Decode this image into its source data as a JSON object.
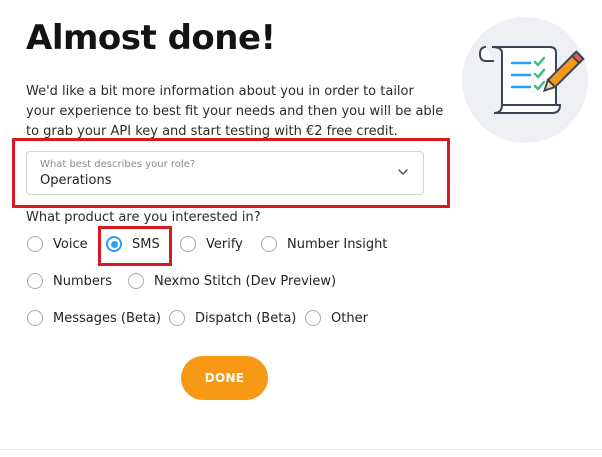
{
  "page": {
    "title": "Almost done!",
    "intro": "We'd like a bit more information about you in order to tailor your experience to best fit your needs and then you will be able to grab your API key and start testing with €2 free credit."
  },
  "role_select": {
    "label": "What best describes your role?",
    "value": "Operations",
    "icon": "chevron-down-icon"
  },
  "products": {
    "question": "What product are you interested in?",
    "options": [
      {
        "label": "Voice",
        "checked": false
      },
      {
        "label": "SMS",
        "checked": true
      },
      {
        "label": "Verify",
        "checked": false
      },
      {
        "label": "Number Insight",
        "checked": false
      },
      {
        "label": "Numbers",
        "checked": false
      },
      {
        "label": "Nexmo Stitch (Dev Preview)",
        "checked": false
      },
      {
        "label": "Messages (Beta)",
        "checked": false
      },
      {
        "label": "Dispatch (Beta)",
        "checked": false
      },
      {
        "label": "Other",
        "checked": false
      }
    ]
  },
  "done_button": {
    "label": "DONE"
  },
  "colors": {
    "accent_orange": "#f79914",
    "radio_selected": "#2a9df4",
    "highlight_red": "#d71922",
    "illustration_circle": "#eef0f3",
    "check_green": "#3fbf82",
    "line_blue": "#2a9df4"
  },
  "illustration": {
    "icon": "checklist-scroll-icon"
  }
}
